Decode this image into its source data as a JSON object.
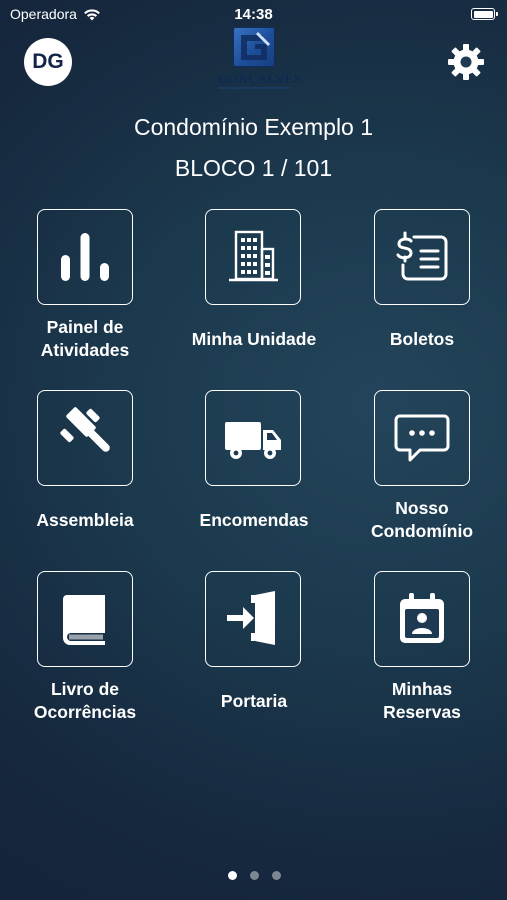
{
  "status_bar": {
    "carrier": "Operadora",
    "time": "14:38",
    "battery_level": 1.0,
    "wifi_icon": "wifi-icon",
    "battery_icon": "battery-icon"
  },
  "header": {
    "avatar_initials": "DG",
    "logo_text": "GONÇALVES",
    "settings_icon": "gear-icon"
  },
  "condo": {
    "name": "Condomínio Exemplo 1",
    "unit": "BLOCO 1 / 101"
  },
  "menu": [
    {
      "icon": "bar-chart-icon",
      "lines": [
        "Painel de",
        "Atividades"
      ]
    },
    {
      "icon": "building-icon",
      "lines": [
        "Minha Unidade"
      ]
    },
    {
      "icon": "invoice-icon",
      "lines": [
        "Boletos"
      ]
    },
    {
      "icon": "gavel-icon",
      "lines": [
        "Assembleia"
      ]
    },
    {
      "icon": "truck-icon",
      "lines": [
        "Encomendas"
      ]
    },
    {
      "icon": "chat-bubble-icon",
      "lines": [
        "Nosso",
        "Condomínio"
      ]
    },
    {
      "icon": "book-icon",
      "lines": [
        "Livro de",
        "Ocorrências"
      ]
    },
    {
      "icon": "door-enter-icon",
      "lines": [
        "Portaria"
      ]
    },
    {
      "icon": "calendar-person-icon",
      "lines": [
        "Minhas",
        "Reservas"
      ]
    }
  ],
  "pagination": {
    "pages": 3,
    "current": 1
  },
  "colors": {
    "accent": "#ffffff",
    "background_dark": "#142238",
    "background_light": "#23445a",
    "avatar_text": "#14234a",
    "dot_inactive": "#7c8792"
  }
}
